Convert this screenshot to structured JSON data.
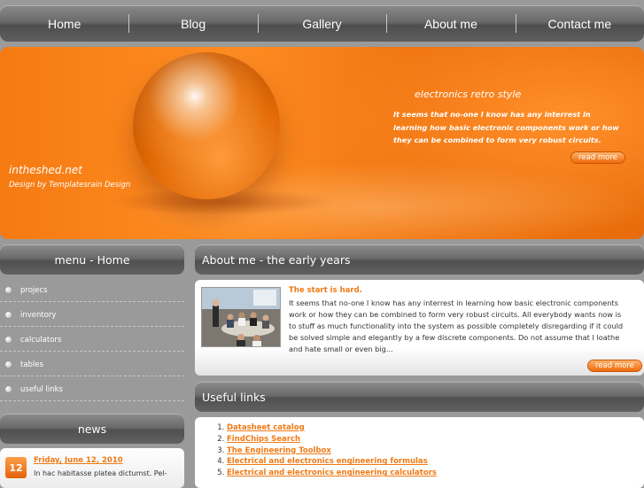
{
  "nav": {
    "items": [
      {
        "label": "Home"
      },
      {
        "label": "Blog"
      },
      {
        "label": "Gallery"
      },
      {
        "label": "About me"
      },
      {
        "label": "Contact me"
      }
    ]
  },
  "banner": {
    "site_name": "intheshed.net",
    "credit": "Design by Templatesrain Design",
    "title": "electronics retro style",
    "text": "It seems that no-one I know has any interrest in learning how basic electronic components work or how they can be combined to form very robust circuits.",
    "read_more": "read more"
  },
  "sidebar": {
    "menu_title": "menu - Home",
    "menu_items": [
      {
        "label": "projecs"
      },
      {
        "label": "inventory"
      },
      {
        "label": "calculators"
      },
      {
        "label": "tables"
      },
      {
        "label": "useful links"
      }
    ],
    "news_title": "news",
    "news": {
      "day": "12",
      "date_link": "Friday, June 12, 2010",
      "text": "In hac habitasse platea dictumst. Pel-"
    }
  },
  "main": {
    "about_title": "About me - the early years",
    "about_post": {
      "title": "The start is hard.",
      "text": "It seems that no-one I know has any interrest in learning how basic electronic components work or how they can be combined to form very robust circuits. All everybody wants now is to stuff as much functionality into the system as possible completely disregarding if it could be solved simple and elegantly by a few discrete components. Do not assume that I loathe and hate small or even big...",
      "read_more": "read more"
    },
    "useful_title": "Useful links",
    "useful_links": [
      {
        "label": "Datasheet catalog"
      },
      {
        "label": "FindChips Search"
      },
      {
        "label": "The Engineering Toolbox"
      },
      {
        "label": "Electrical and electronics engineering formulas"
      },
      {
        "label": "Electrical and electronics engineering calculators"
      }
    ]
  }
}
